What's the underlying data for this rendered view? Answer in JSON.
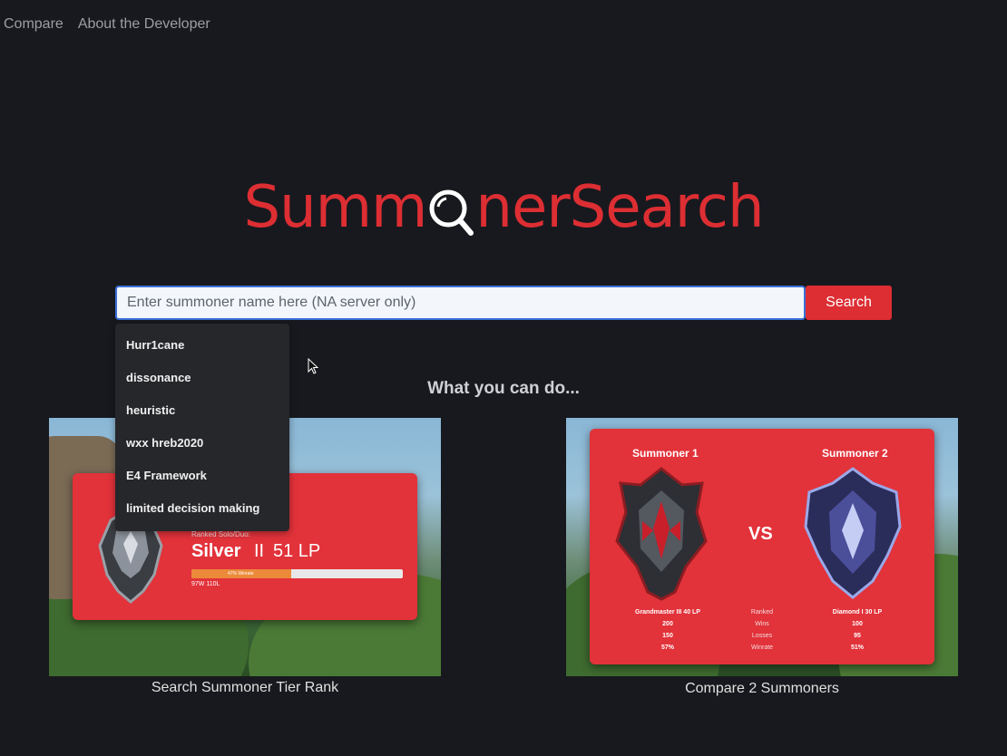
{
  "nav": {
    "items": [
      "Compare",
      "About the Developer"
    ]
  },
  "logo": {
    "left": "Summ",
    "right": "nerSearch"
  },
  "search": {
    "placeholder": "Enter summoner name here (NA server only)",
    "button": "Search"
  },
  "suggestions": [
    "Hurr1cane",
    "dissonance",
    "heuristic",
    "wxx hreb2020",
    "E4 Framework",
    "limited decision making"
  ],
  "section_title": "What you can do...",
  "card1": {
    "caption": "Search Summoner Tier Rank",
    "ranked_label": "Ranked Solo/Duo:",
    "tier": "Silver",
    "division": "II",
    "lp": "51 LP",
    "winrate_text": "47% Winrate",
    "winrate": 0.47,
    "wl": "97W 110L"
  },
  "card2": {
    "caption": "Compare 2 Summoners",
    "s1_title": "Summoner 1",
    "s2_title": "Summoner 2",
    "vs": "VS",
    "s1": [
      "Grandmaster III 40 LP",
      "200",
      "150",
      "57%"
    ],
    "labels": [
      "Ranked",
      "Wins",
      "Losses",
      "Winrate"
    ],
    "s2": [
      "Diamond I 30 LP",
      "100",
      "95",
      "51%"
    ]
  },
  "colors": {
    "brand_red": "#dc2e33",
    "background": "#17191e",
    "input_border": "#3a6fd8"
  }
}
